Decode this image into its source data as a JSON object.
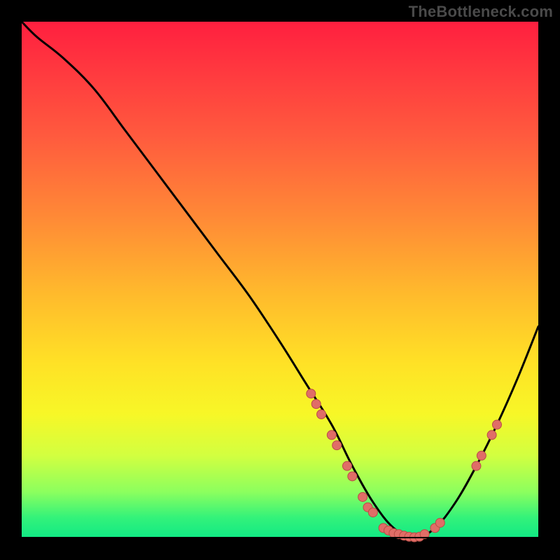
{
  "watermark": "TheBottleneck.com",
  "colors": {
    "background": "#000000",
    "curve": "#000000",
    "marker_fill": "#e06d67",
    "marker_stroke": "#b94d46"
  },
  "chart_data": {
    "type": "line",
    "title": "",
    "xlabel": "",
    "ylabel": "",
    "xlim": [
      0,
      100
    ],
    "ylim": [
      0,
      100
    ],
    "series": [
      {
        "name": "bottleneck-curve",
        "x": [
          0,
          3,
          8,
          14,
          20,
          26,
          32,
          38,
          44,
          50,
          55,
          60,
          64,
          68,
          72,
          76,
          80,
          84,
          88,
          92,
          96,
          100
        ],
        "y": [
          100,
          97,
          93,
          87,
          79,
          71,
          63,
          55,
          47,
          38,
          30,
          22,
          14,
          7,
          2,
          0,
          2,
          7,
          14,
          22,
          31,
          41
        ]
      }
    ],
    "markers": [
      {
        "x": 56,
        "y": 28
      },
      {
        "x": 57,
        "y": 26
      },
      {
        "x": 58,
        "y": 24
      },
      {
        "x": 60,
        "y": 20
      },
      {
        "x": 61,
        "y": 18
      },
      {
        "x": 63,
        "y": 14
      },
      {
        "x": 64,
        "y": 12
      },
      {
        "x": 66,
        "y": 8
      },
      {
        "x": 67,
        "y": 6
      },
      {
        "x": 68,
        "y": 5
      },
      {
        "x": 70,
        "y": 2
      },
      {
        "x": 71,
        "y": 1.5
      },
      {
        "x": 72,
        "y": 1
      },
      {
        "x": 73,
        "y": 0.8
      },
      {
        "x": 74,
        "y": 0.5
      },
      {
        "x": 75,
        "y": 0.3
      },
      {
        "x": 76,
        "y": 0.2
      },
      {
        "x": 77,
        "y": 0.3
      },
      {
        "x": 78,
        "y": 0.8
      },
      {
        "x": 80,
        "y": 2
      },
      {
        "x": 81,
        "y": 3
      },
      {
        "x": 88,
        "y": 14
      },
      {
        "x": 89,
        "y": 16
      },
      {
        "x": 91,
        "y": 20
      },
      {
        "x": 92,
        "y": 22
      }
    ]
  }
}
